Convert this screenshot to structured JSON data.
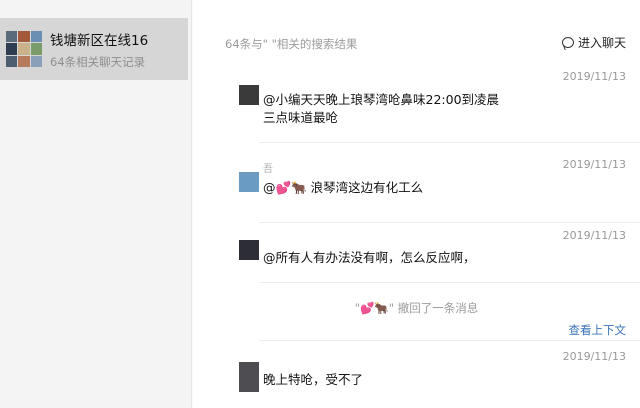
{
  "sidebar": {
    "chat": {
      "name": "钱塘新区在线16",
      "subtitle": "64条相关聊天记录",
      "avatar_colors": [
        "#5a6b7c",
        "#a3593a",
        "#6b8fb3",
        "#2f3d52",
        "#c9b28a",
        "#7a9b6a",
        "#4d5e70",
        "#b67a5c",
        "#8aa0b8"
      ]
    }
  },
  "header": {
    "result_title": "64条与\"   \"相关的搜索结果",
    "enter_chat_label": "进入聊天"
  },
  "messages": [
    {
      "time": "2019/11/13",
      "sender": "",
      "text_line1": "@小编天天晚上琅琴湾呛鼻味22:00到凌晨",
      "text_line2": "三点味道最呛",
      "avatar_color": "#3a3a3a"
    },
    {
      "time": "2019/11/13",
      "sender": "吾",
      "text_prefix": "@",
      "text_emoji1": "💕",
      "text_emoji2": "🐂",
      "text_rest": " 浪琴湾这边有化工么",
      "avatar_color": "#6a9bc2"
    },
    {
      "time": "2019/11/13",
      "sender": "",
      "text_line1": "@所有人有办法没有啊，怎么反应啊，",
      "avatar_color": "#2d2d35"
    },
    {
      "time": "2019/11/13",
      "sender": "",
      "text_line1": "晚上特呛，受不了",
      "avatar_color": "#4d4d52"
    }
  ],
  "recall": {
    "quote_open": "\"",
    "emoji1": "💕",
    "emoji2": "🐂",
    "quote_close": "\"",
    "text": " 撤回了一条消息"
  },
  "view_context_label": "查看上下文"
}
